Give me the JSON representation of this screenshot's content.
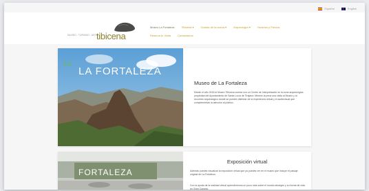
{
  "lang": [
    {
      "label": "Español",
      "flag": "spain-flag"
    },
    {
      "label": "English",
      "flag": "uk-flag"
    }
  ],
  "brand": {
    "name": "tibicena",
    "tagline": "MUSEO · TURISMO · ARTE"
  },
  "nav": [
    "Museo La Fortaleza",
    "Tibicena ▾",
    "Guiado de la cueva ▾",
    "Arqueología ▾",
    "Horarios y Precios",
    "Reserva tu Visita",
    "Contáctanos"
  ],
  "museo": {
    "logo_text": "LA FORTALEZA",
    "title": "Museo de La Fortaleza",
    "text": "Desde el año 2018 el Museo Tibicena cuenta con un Centro de Interpretación en la zona arqueológica propiedad del Ayuntamiento de Santa Lucía de Tirajana. Merece la pena una visita al Museo y al recorrido arqueológico donde se pueden disfrutar de la experiencia virtual y el audiovisual que complementan la atención al público."
  },
  "experiencia": {
    "title": "Exposición virtual",
    "text1": "Además puedes visualizar la exposición virtual que ya puedes ver en el museo que incluye el paisaje original de La Fortaleza.",
    "text2": "Con la ayuda de la realidad virtual aprenderemos un poco más sobre el mundo aborigen y su forma de vida en Gran Canaria."
  },
  "colors": {
    "accent": "#c9a227",
    "brand": "#8b7e2a"
  }
}
